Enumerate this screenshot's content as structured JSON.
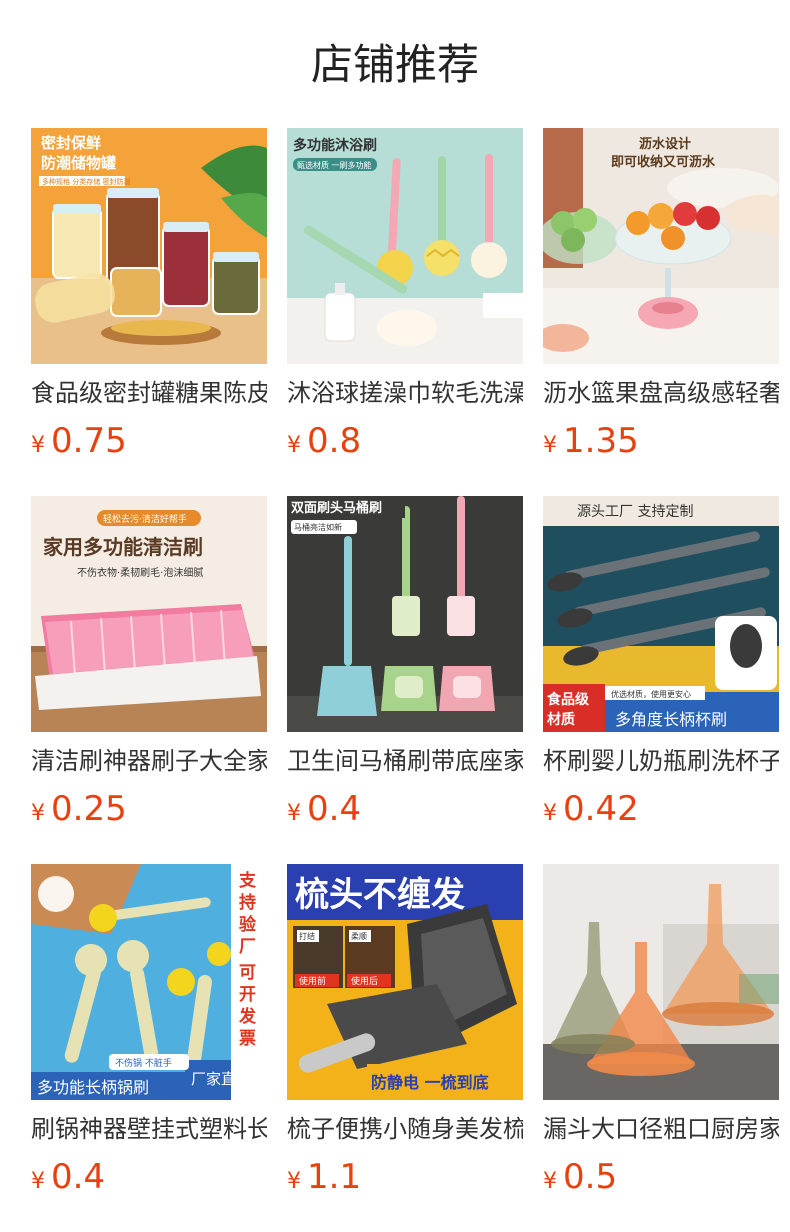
{
  "header": {
    "title": "店铺推荐"
  },
  "currency_symbol": "¥",
  "products": [
    {
      "name": "食品级密封罐糖果陈皮",
      "price": "0.75",
      "image_text": [
        "密封保鲜",
        "防潮储物罐",
        "多种规格 分类存储 密封防潮"
      ]
    },
    {
      "name": "沐浴球搓澡巾软毛洗澡",
      "price": "0.8",
      "image_text": [
        "多功能沐浴刷",
        "甄选材质 一刷多功能"
      ]
    },
    {
      "name": "沥水篮果盘高级感轻奢",
      "price": "1.35",
      "image_text": [
        "沥水设计",
        "即可收纳又可沥水"
      ]
    },
    {
      "name": "清洁刷神器刷子大全家",
      "price": "0.25",
      "image_text": [
        "轻松去污·清洁好帮手",
        "家用多功能清洁刷",
        "不伤衣物·柔韧刷毛·泡沫细腻"
      ]
    },
    {
      "name": "卫生间马桶刷带底座家",
      "price": "0.4",
      "image_text": [
        "双面刷头马桶刷",
        "马桶亮洁如新"
      ]
    },
    {
      "name": "杯刷婴儿奶瓶刷洗杯子",
      "price": "0.42",
      "image_text": [
        "源头工厂  支持定制",
        "食品级",
        "材质",
        "优选材质，使用更安心",
        "多角度长柄杯刷"
      ]
    },
    {
      "name": "刷锅神器壁挂式塑料长",
      "price": "0.4",
      "image_text": [
        "支持验厂",
        "可开发票",
        "不伤锅 不脏手",
        "多功能长柄锅刷",
        "厂家直供"
      ]
    },
    {
      "name": "梳子便携小随身美发梳",
      "price": "1.1",
      "image_text": [
        "梳头不缠发",
        "打结",
        "柔顺",
        "使用前",
        "使用后",
        "防静电 一梳到底"
      ]
    },
    {
      "name": "漏斗大口径粗口厨房家",
      "price": "0.5",
      "image_text": []
    }
  ]
}
